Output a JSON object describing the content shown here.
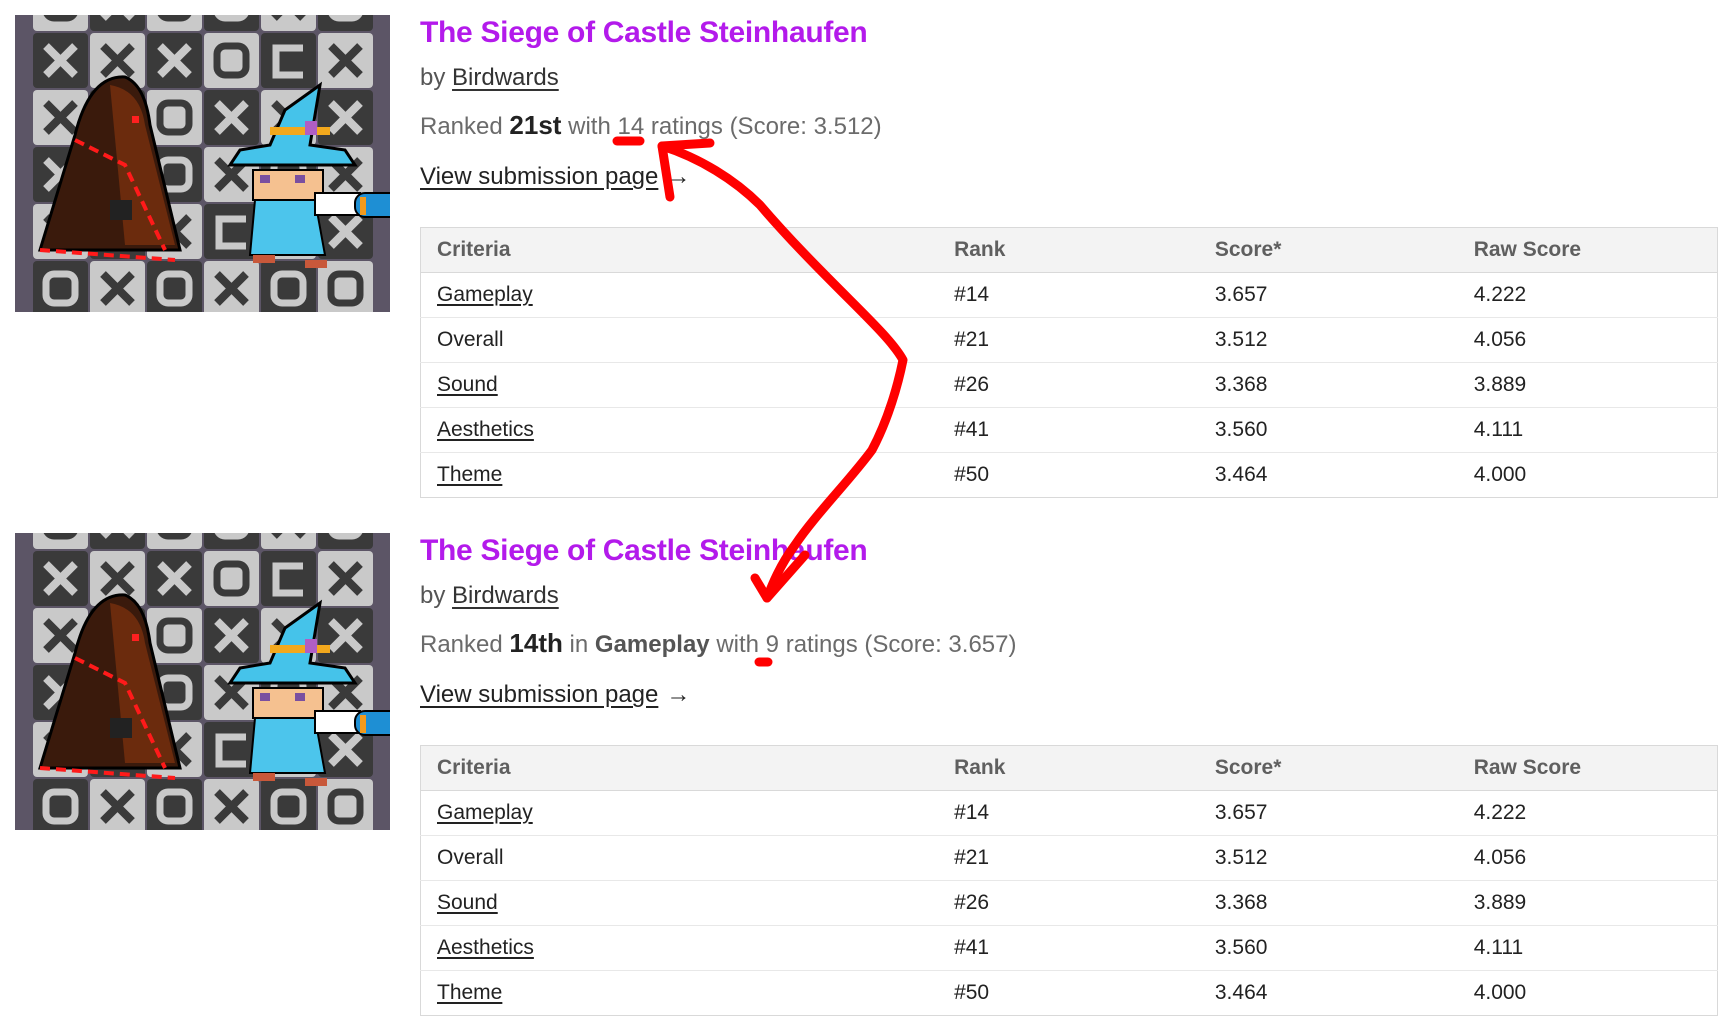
{
  "annotation_color": "#ff0000",
  "title_color": "#b31aeb",
  "entries": [
    {
      "thumbnail_alt": "pixel-art-thumbnail: hooded figure and blue wizard on tic-tac-toe board",
      "title": "The Siege of Castle Steinhaufen",
      "by_prefix": "by",
      "author": "Birdwards",
      "ranked_prefix": "Ranked",
      "rank": "21st",
      "category_prefix": "",
      "category": "",
      "with_label": "with",
      "ratings_count": "14",
      "ratings_suffix": "ratings (Score: 3.512)",
      "view_label": "View submission page",
      "view_arrow": "→",
      "table": {
        "headers": [
          "Criteria",
          "Rank",
          "Score*",
          "Raw Score"
        ],
        "rows": [
          {
            "criteria": "Gameplay",
            "link": true,
            "rank": "#14",
            "score": "3.657",
            "raw": "4.222"
          },
          {
            "criteria": "Overall",
            "link": false,
            "rank": "#21",
            "score": "3.512",
            "raw": "4.056"
          },
          {
            "criteria": "Sound",
            "link": true,
            "rank": "#26",
            "score": "3.368",
            "raw": "3.889"
          },
          {
            "criteria": "Aesthetics",
            "link": true,
            "rank": "#41",
            "score": "3.560",
            "raw": "4.111"
          },
          {
            "criteria": "Theme",
            "link": true,
            "rank": "#50",
            "score": "3.464",
            "raw": "4.000"
          }
        ]
      }
    },
    {
      "thumbnail_alt": "pixel-art-thumbnail: hooded figure and blue wizard on tic-tac-toe board",
      "title": "The Siege of Castle Steinhaufen",
      "by_prefix": "by",
      "author": "Birdwards",
      "ranked_prefix": "Ranked",
      "rank": "14th",
      "category_prefix": "in",
      "category": "Gameplay",
      "with_label": "with",
      "ratings_count": "9",
      "ratings_suffix": "ratings (Score: 3.657)",
      "view_label": "View submission page",
      "view_arrow": "→",
      "table": {
        "headers": [
          "Criteria",
          "Rank",
          "Score*",
          "Raw Score"
        ],
        "rows": [
          {
            "criteria": "Gameplay",
            "link": true,
            "rank": "#14",
            "score": "3.657",
            "raw": "4.222"
          },
          {
            "criteria": "Overall",
            "link": false,
            "rank": "#21",
            "score": "3.512",
            "raw": "4.056"
          },
          {
            "criteria": "Sound",
            "link": true,
            "rank": "#26",
            "score": "3.368",
            "raw": "3.889"
          },
          {
            "criteria": "Aesthetics",
            "link": true,
            "rank": "#41",
            "score": "3.560",
            "raw": "4.111"
          },
          {
            "criteria": "Theme",
            "link": true,
            "rank": "#50",
            "score": "3.464",
            "raw": "4.000"
          }
        ]
      }
    }
  ]
}
